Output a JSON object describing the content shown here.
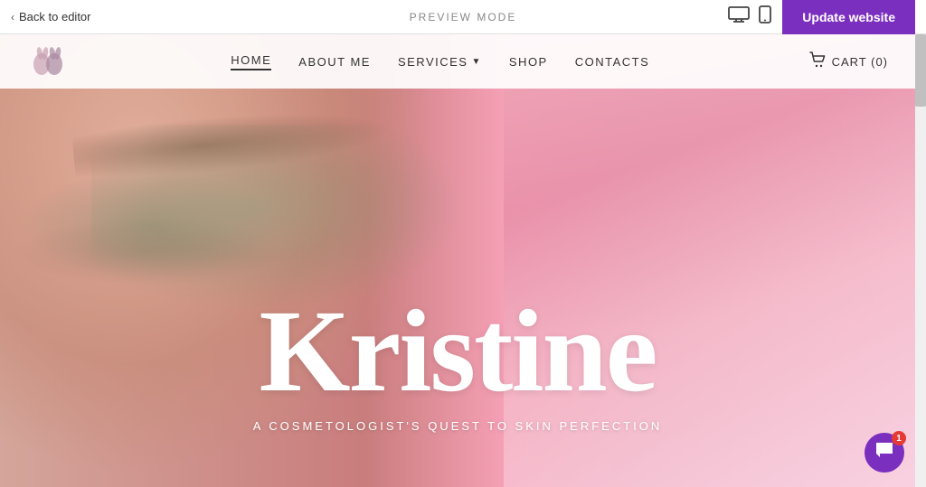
{
  "topbar": {
    "back_label": "Back to editor",
    "preview_mode_label": "PREVIEW MODE",
    "update_label": "Update website"
  },
  "nav": {
    "logo_alt": "Logo",
    "links": [
      {
        "id": "home",
        "label": "HOME",
        "active": true,
        "has_dropdown": false
      },
      {
        "id": "about",
        "label": "ABOUT ME",
        "active": false,
        "has_dropdown": false
      },
      {
        "id": "services",
        "label": "SERVICES",
        "active": false,
        "has_dropdown": true
      },
      {
        "id": "shop",
        "label": "SHOP",
        "active": false,
        "has_dropdown": false
      },
      {
        "id": "contacts",
        "label": "CONTACTS",
        "active": false,
        "has_dropdown": false
      }
    ],
    "cart_label": "CART (0)"
  },
  "hero": {
    "title": "Kristine",
    "subtitle": "A COSMETOLOGIST'S QUEST TO SKIN PERFECTION"
  },
  "chat": {
    "badge_count": "1"
  },
  "devices": {
    "desktop_label": "Desktop view",
    "mobile_label": "Mobile view"
  }
}
